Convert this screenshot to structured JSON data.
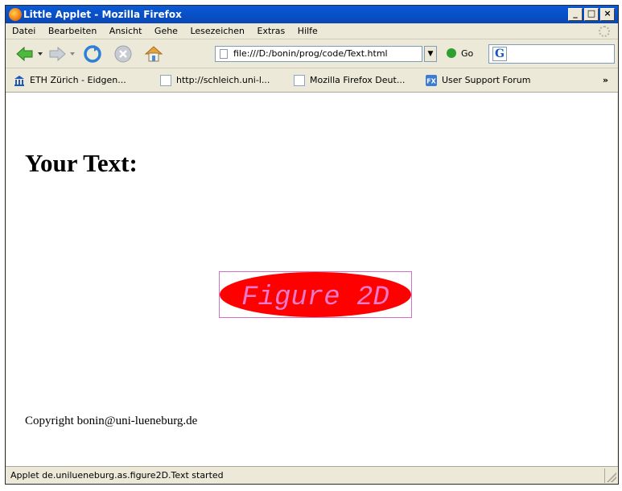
{
  "window": {
    "title": "Little Applet - Mozilla Firefox",
    "min_btn": "_",
    "max_btn": "□",
    "close_btn": "×"
  },
  "menu": [
    "Datei",
    "Bearbeiten",
    "Ansicht",
    "Gehe",
    "Lesezeichen",
    "Extras",
    "Hilfe"
  ],
  "toolbar": {
    "url": "file:///D:/bonin/prog/code/Text.html",
    "go_label": "Go"
  },
  "bookmarks": {
    "items": [
      "ETH Zürich - Eidgen...",
      "http://schleich.uni-l...",
      "Mozilla Firefox Deut...",
      "User Support Forum"
    ],
    "overflow": "»"
  },
  "page": {
    "heading": "Your Text:",
    "applet_text": "Figure 2D",
    "copyright": "Copyright bonin@uni-lueneburg.de"
  },
  "status": {
    "text": "Applet de.unilueneburg.as.figure2D.Text started"
  },
  "colors": {
    "ellipse_fill": "#ff0000",
    "applet_text": "#e879c8",
    "title_bar": "#0a5ad8"
  }
}
